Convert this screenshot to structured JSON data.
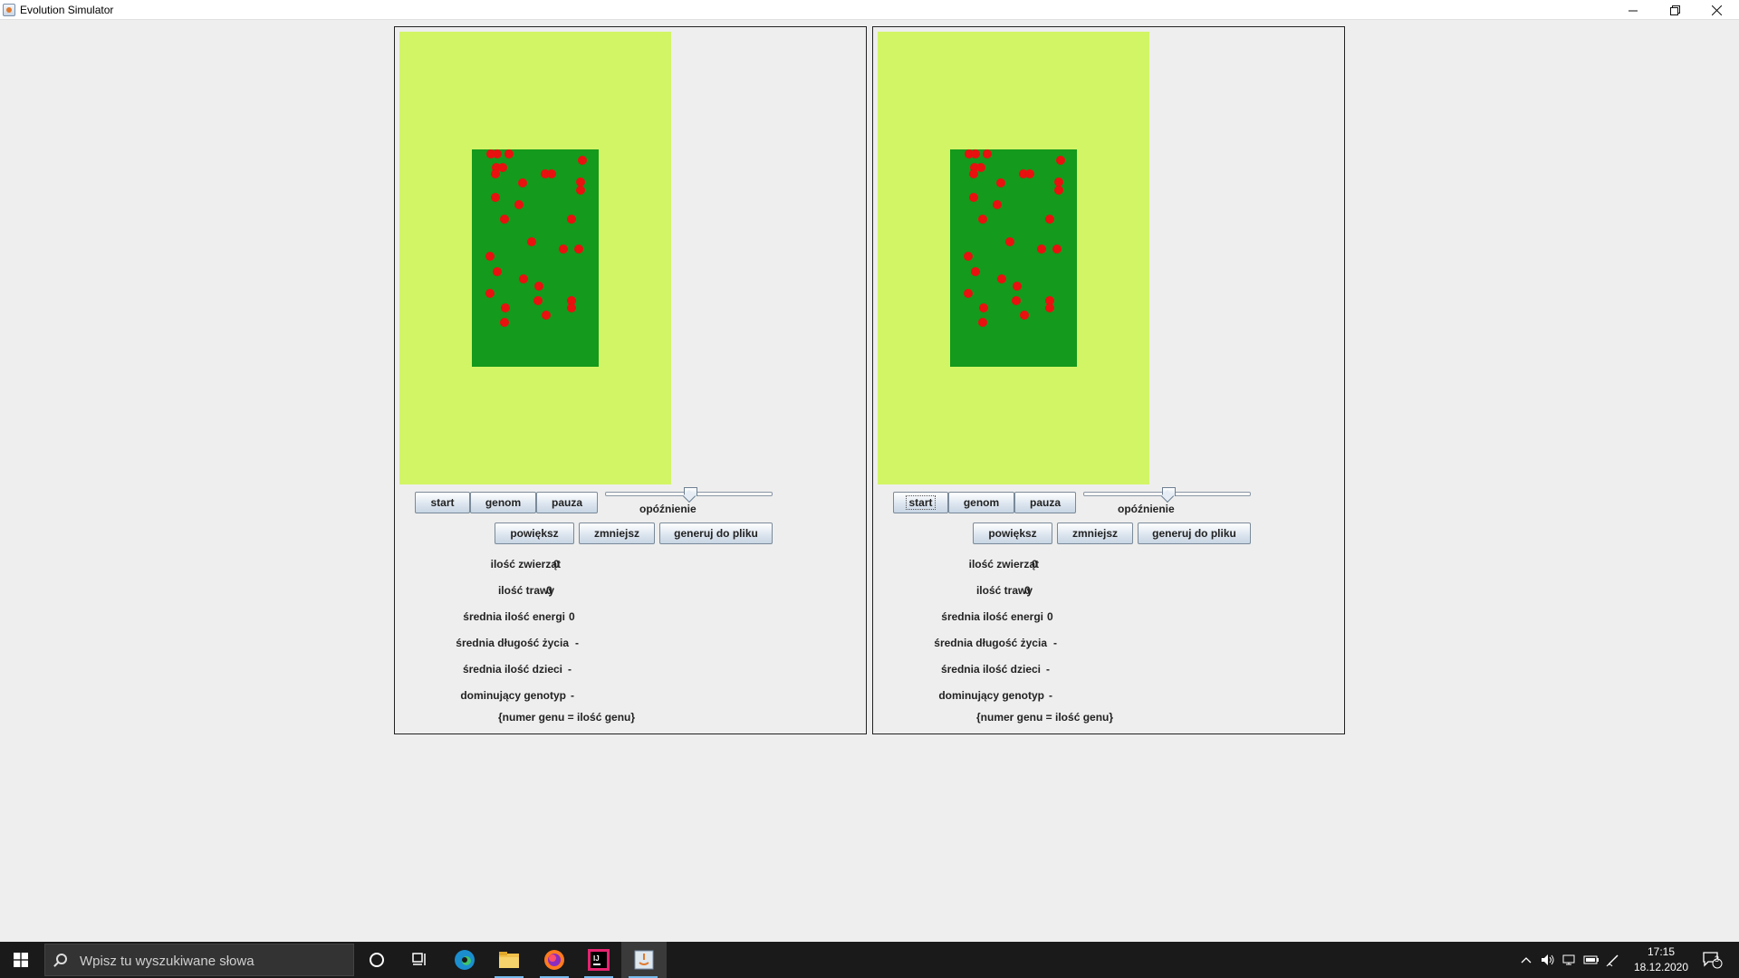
{
  "window": {
    "title": "Evolution Simulator"
  },
  "panels": [
    {
      "controls": {
        "start": "start",
        "genome": "genom",
        "pause": "pauza",
        "zoom_in": "powiększ",
        "zoom_out": "zmniejsz",
        "export": "generuj do pliku"
      },
      "delay_slider": {
        "label": "opóźnienie",
        "value": 0.5
      },
      "stats": {
        "animals_label": "ilość zwierząt",
        "animals_value": "0",
        "grass_label": "ilość trawy",
        "grass_value": "0",
        "avg_energy_label": "średnia ilość energi",
        "avg_energy_value": "0",
        "avg_lifespan_label": "średnia długość życia",
        "avg_lifespan_value": "-",
        "avg_children_label": "średnia ilość dzieci",
        "avg_children_value": "-",
        "dominant_genotype_label": "dominujący genotyp",
        "dominant_genotype_value": "-",
        "genotype_legend": "{numer genu = ilość genu}"
      },
      "start_focused": false
    },
    {
      "controls": {
        "start": "start",
        "genome": "genom",
        "pause": "pauza",
        "zoom_in": "powiększ",
        "zoom_out": "zmniejsz",
        "export": "generuj do pliku"
      },
      "delay_slider": {
        "label": "opóźnienie",
        "value": 0.5
      },
      "stats": {
        "animals_label": "ilość zwierząt",
        "animals_value": "0",
        "grass_label": "ilość trawy",
        "grass_value": "0",
        "avg_energy_label": "średnia ilość energi",
        "avg_energy_value": "0",
        "avg_lifespan_label": "średnia długość życia",
        "avg_lifespan_value": "-",
        "avg_children_label": "średnia ilość dzieci",
        "avg_children_value": "-",
        "dominant_genotype_label": "dominujący genotyp",
        "dominant_genotype_value": "-",
        "genotype_legend": "{numer genu = ilość genu}"
      },
      "start_focused": true
    }
  ],
  "colors": {
    "steppe": "#d2f566",
    "jungle": "#149a1c",
    "animal": "#e8110f"
  },
  "taskbar": {
    "search_placeholder": "Wpisz tu wyszukiwane słowa",
    "pinned_apps": [
      "cortana-icon",
      "task-view-icon",
      "edge-icon",
      "file-explorer-icon",
      "firefox-icon",
      "intellij-icon",
      "java-icon"
    ],
    "clock_time": "17:15",
    "clock_date": "18.12.2020",
    "notification_count": "3"
  }
}
